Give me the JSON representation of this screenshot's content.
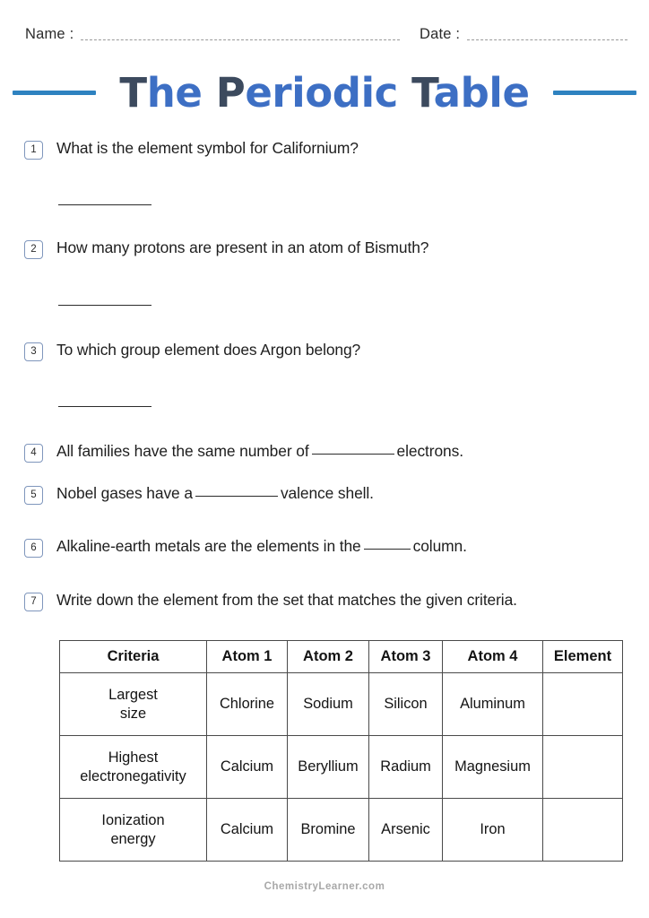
{
  "header": {
    "name_label": "Name :",
    "date_label": "Date :"
  },
  "title": {
    "full": "The Periodic Table",
    "seg_T": "T",
    "seg_he": "he ",
    "seg_P": "P",
    "seg_eriodic": "eriodic ",
    "seg_T2": "T",
    "seg_able": "able",
    "accent_color": "#2e82c0",
    "cap_color": "#3c4a5e",
    "body_color": "#3d6fc4"
  },
  "questions": [
    {
      "number": "1",
      "text": "What is the element symbol for Californium?",
      "has_answer_rule": true
    },
    {
      "number": "2",
      "text": "How many protons are present in an atom of Bismuth?",
      "has_answer_rule": true
    },
    {
      "number": "3",
      "text": "To which group element does Argon belong?",
      "has_answer_rule": true
    },
    {
      "number": "4",
      "text_before": "All families have the same number of",
      "blank": "long",
      "text_after": "electrons.",
      "has_answer_rule": false
    },
    {
      "number": "5",
      "text_before": "Nobel gases have a",
      "blank": "long",
      "text_after": "valence shell.",
      "has_answer_rule": false
    },
    {
      "number": "6",
      "text_before": "Alkaline-earth metals are the elements in the",
      "blank": "short",
      "text_after": "column.",
      "has_answer_rule": false
    },
    {
      "number": "7",
      "text": "Write down the element from the set that matches the given criteria.",
      "has_answer_rule": false
    }
  ],
  "table": {
    "headers": [
      "Criteria",
      "Atom 1",
      "Atom 2",
      "Atom 3",
      "Atom 4",
      "Element"
    ],
    "rows": [
      {
        "criteria_line1": "Largest",
        "criteria_line2": "size",
        "atom1": "Chlorine",
        "atom2": "Sodium",
        "atom3": "Silicon",
        "atom4": "Aluminum",
        "element": ""
      },
      {
        "criteria_line1": "Highest",
        "criteria_line2": "electronegativity",
        "atom1": "Calcium",
        "atom2": "Beryllium",
        "atom3": "Radium",
        "atom4": "Magnesium",
        "element": ""
      },
      {
        "criteria_line1": "Ionization",
        "criteria_line2": "energy",
        "atom1": "Calcium",
        "atom2": "Bromine",
        "atom3": "Arsenic",
        "atom4": "Iron",
        "element": ""
      }
    ]
  },
  "footer": {
    "brand": "ChemistryLearner.com"
  }
}
